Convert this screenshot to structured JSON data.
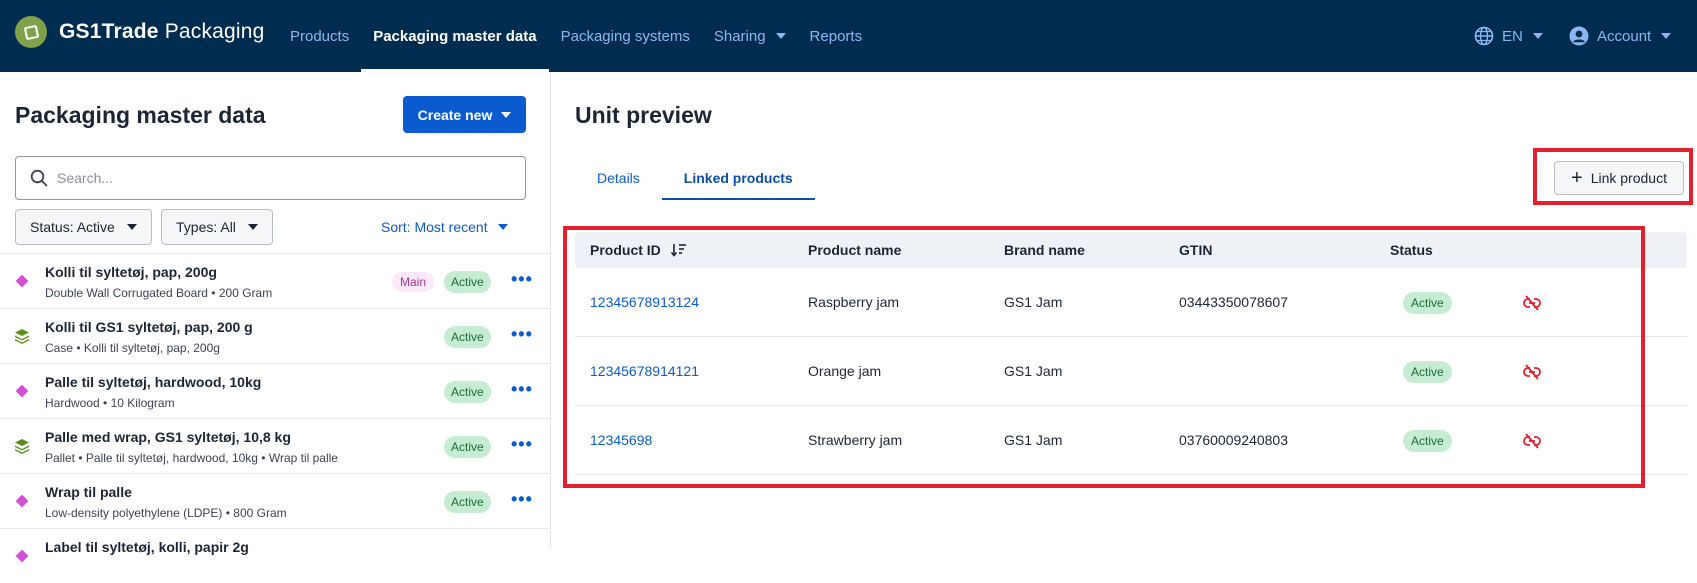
{
  "header": {
    "brand_name_bold": "GS1Trade",
    "brand_name_rest": " Packaging",
    "nav": [
      {
        "label": "Products"
      },
      {
        "label": "Packaging master data"
      },
      {
        "label": "Packaging systems"
      },
      {
        "label": "Sharing"
      },
      {
        "label": "Reports"
      }
    ],
    "language": "EN",
    "account": "Account"
  },
  "left_panel": {
    "title": "Packaging master data",
    "create_button": "Create new",
    "search_placeholder": "Search...",
    "status_filter": "Status: Active",
    "types_filter": "Types: All",
    "sort": "Sort: Most recent",
    "items": [
      {
        "title": "Kolli til syltetøj, pap, 200g",
        "subtitle": "Double Wall Corrugated Board • 200 Gram",
        "main_badge": "Main",
        "status": "Active",
        "icon": "diamond-icon"
      },
      {
        "title": "Kolli til GS1 syltetøj, pap, 200 g",
        "subtitle": "Case • Kolli til syltetøj, pap, 200g",
        "status": "Active",
        "icon": "layers-icon"
      },
      {
        "title": "Palle til syltetøj, hardwood, 10kg",
        "subtitle": "Hardwood • 10 Kilogram",
        "status": "Active",
        "icon": "diamond-icon"
      },
      {
        "title": "Palle med wrap, GS1 syltetøj, 10,8 kg",
        "subtitle": "Pallet • Palle til syltetøj, hardwood, 10kg • Wrap til palle",
        "status": "Active",
        "icon": "layers-icon"
      },
      {
        "title": "Wrap til palle",
        "subtitle": "Low-density polyethylene (LDPE) • 800 Gram",
        "status": "Active",
        "icon": "diamond-icon"
      },
      {
        "title": "Label til syltetøj, kolli, papir 2g",
        "subtitle": "",
        "status": "",
        "icon": "diamond-icon"
      }
    ]
  },
  "right_panel": {
    "title": "Unit preview",
    "tabs": [
      {
        "label": "Details"
      },
      {
        "label": "Linked products"
      }
    ],
    "link_button": "Link product",
    "table": {
      "headers": [
        "Product ID",
        "Product name",
        "Brand name",
        "GTIN",
        "Status"
      ],
      "rows": [
        {
          "product_id": "12345678913124",
          "product_name": "Raspberry jam",
          "brand_name": "GS1 Jam",
          "gtin": "03443350078607",
          "status": "Active"
        },
        {
          "product_id": "12345678914121",
          "product_name": "Orange jam",
          "brand_name": "GS1 Jam",
          "gtin": "",
          "status": "Active"
        },
        {
          "product_id": "12345698",
          "product_name": "Strawberry jam",
          "brand_name": "GS1 Jam",
          "gtin": "03760009240803",
          "status": "Active"
        }
      ]
    }
  },
  "colors": {
    "navy": "#002c50",
    "accent_blue": "#0a5bd0",
    "highlight_red": "#e3202d",
    "active_green": "#c6ecd3",
    "diamond_pink": "#d34fd6",
    "layers_green": "#5a8f1e"
  }
}
